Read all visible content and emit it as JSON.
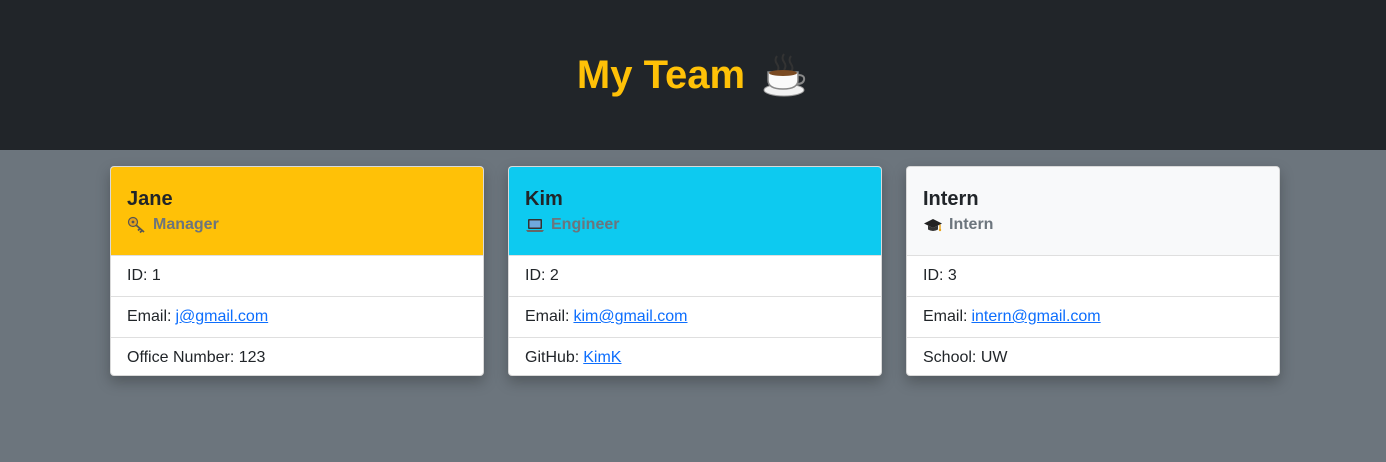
{
  "header": {
    "title": "My Team",
    "icon": "coffee-cup-icon",
    "color": "#ffc107",
    "background": "#212529"
  },
  "page": {
    "background": "#6c757d"
  },
  "cards": [
    {
      "name": "Jane",
      "role": "Manager",
      "role_icon": "key-icon",
      "header_color": "#ffc107",
      "id_label": "ID:",
      "id": "1",
      "email_label": "Email:",
      "email": "j@gmail.com",
      "extra_label": "Office Number:",
      "extra_value": "123"
    },
    {
      "name": "Kim",
      "role": "Engineer",
      "role_icon": "laptop-icon",
      "header_color": "#0dcaf0",
      "id_label": "ID:",
      "id": "2",
      "email_label": "Email:",
      "email": "kim@gmail.com",
      "extra_label": "GitHub:",
      "extra_value": "KimK"
    },
    {
      "name": "Intern",
      "role": "Intern",
      "role_icon": "graduation-cap-icon",
      "header_color": "#f8f9fa",
      "id_label": "ID:",
      "id": "3",
      "email_label": "Email:",
      "email": "intern@gmail.com",
      "extra_label": "School:",
      "extra_value": "UW"
    }
  ]
}
